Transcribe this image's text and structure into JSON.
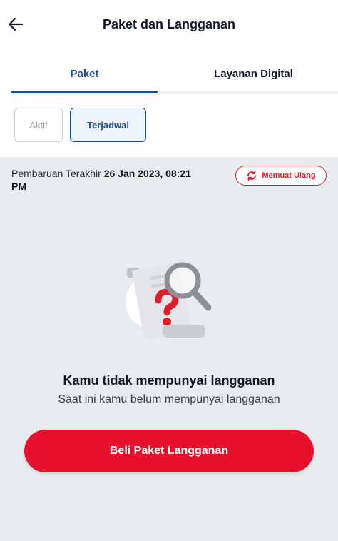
{
  "header": {
    "title": "Paket dan Langganan",
    "back_icon": "arrow-left-icon"
  },
  "tabs": [
    {
      "label": "Paket",
      "active": true
    },
    {
      "label": "Layanan Digital",
      "active": false
    }
  ],
  "filters": [
    {
      "label": "Aktif",
      "selected": false
    },
    {
      "label": "Terjadwal",
      "selected": true
    }
  ],
  "update": {
    "label": "Pembaruan Terakhir",
    "date_line1": "26 Jan 2023, 08:21",
    "date_line2": "PM"
  },
  "reload": {
    "label": "Memuat Ulang",
    "icon": "refresh-icon"
  },
  "empty_state": {
    "illustration": "document-question-magnifier-illustration",
    "title": "Kamu tidak mempunyai langganan",
    "subtitle": "Saat ini kamu belum mempunyai langganan"
  },
  "buy_button": {
    "label": "Beli Paket Langganan"
  },
  "colors": {
    "primary_blue": "#1e4f8a",
    "accent_red": "#e8112d",
    "content_bg": "#e9ecef"
  }
}
